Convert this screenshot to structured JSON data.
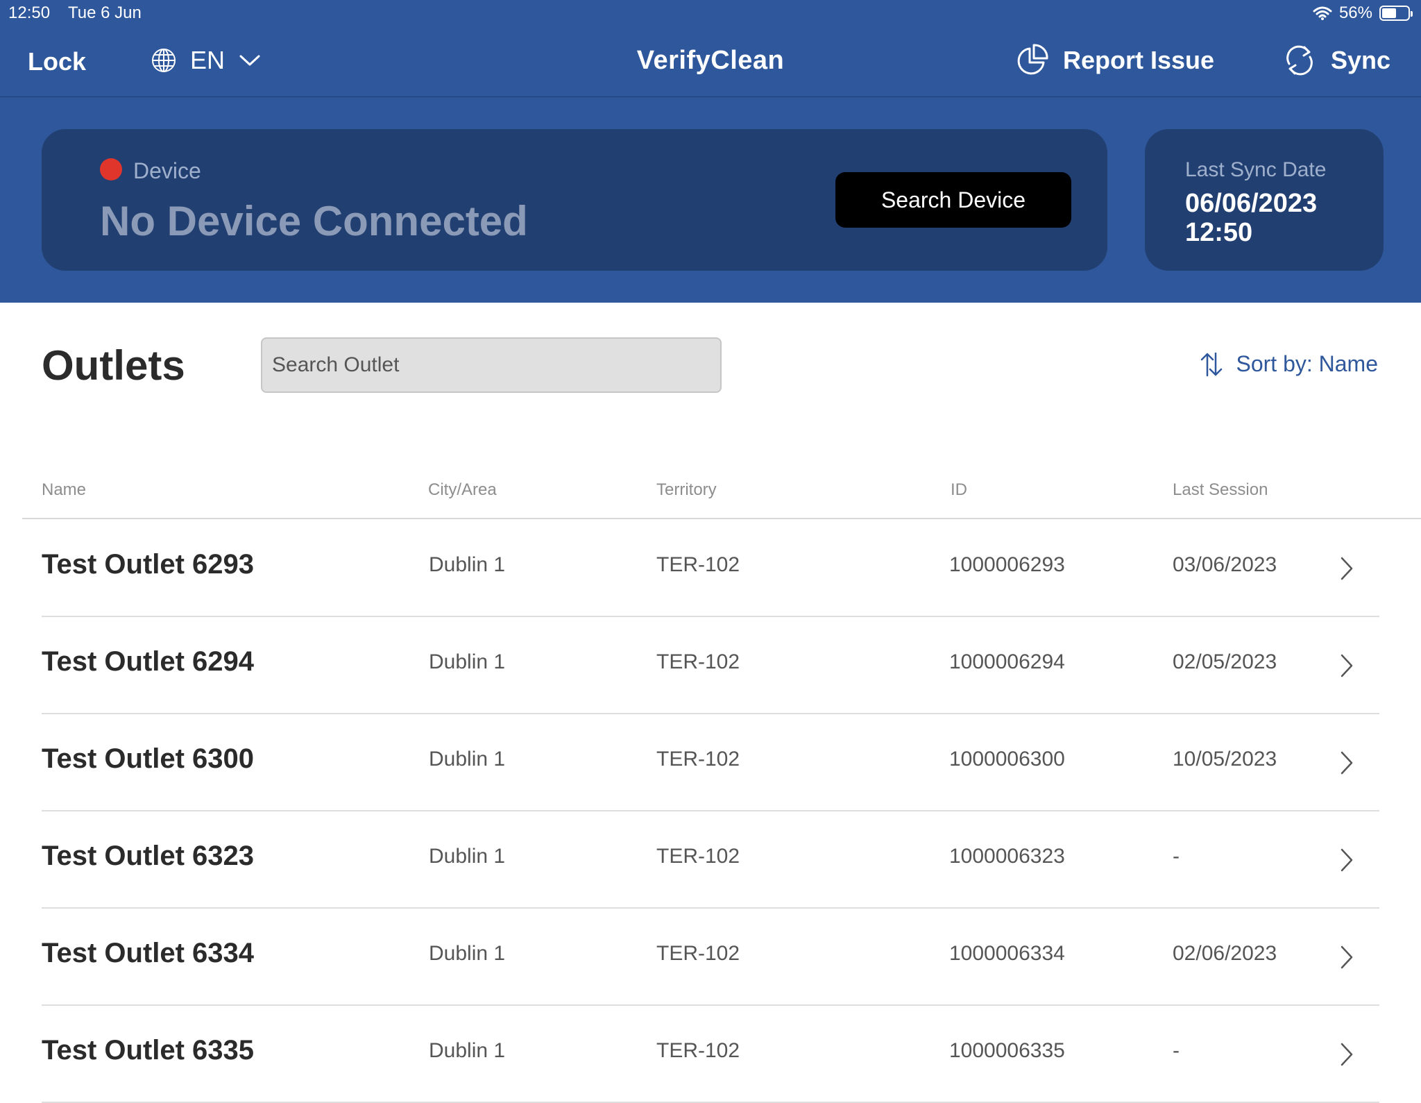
{
  "status_bar": {
    "time": "12:50",
    "date": "Tue 6 Jun",
    "battery": "56%",
    "battery_level": 0.56
  },
  "nav": {
    "lock_label": "Lock",
    "language": "EN",
    "title": "VerifyClean",
    "report_label": "Report Issue",
    "sync_label": "Sync"
  },
  "device": {
    "label": "Device",
    "status": "No Device Connected",
    "status_color": "#e0352b",
    "search_button": "Search Device"
  },
  "last_sync": {
    "label": "Last Sync Date",
    "date": "06/06/2023",
    "time": "12:50"
  },
  "outlets": {
    "title": "Outlets",
    "search_placeholder": "Search Outlet",
    "sort_label": "Sort by: Name",
    "columns": [
      "Name",
      "City/Area",
      "Territory",
      "ID",
      "Last Session"
    ],
    "rows": [
      {
        "name": "Test Outlet 6293",
        "city": "Dublin 1",
        "territory": "TER-102",
        "id": "1000006293",
        "last_session": "03/06/2023"
      },
      {
        "name": "Test Outlet 6294",
        "city": "Dublin 1",
        "territory": "TER-102",
        "id": "1000006294",
        "last_session": "02/05/2023"
      },
      {
        "name": "Test Outlet 6300",
        "city": "Dublin 1",
        "territory": "TER-102",
        "id": "1000006300",
        "last_session": "10/05/2023"
      },
      {
        "name": "Test Outlet 6323",
        "city": "Dublin 1",
        "territory": "TER-102",
        "id": "1000006323",
        "last_session": "-"
      },
      {
        "name": "Test Outlet 6334",
        "city": "Dublin 1",
        "territory": "TER-102",
        "id": "1000006334",
        "last_session": "02/06/2023"
      },
      {
        "name": "Test Outlet 6335",
        "city": "Dublin 1",
        "territory": "TER-102",
        "id": "1000006335",
        "last_session": "-"
      }
    ]
  },
  "colors": {
    "header_blue": "#2e579c",
    "card_blue": "#223f72",
    "accent": "#2e579c"
  },
  "icons": [
    "globe-icon",
    "chevron-down-icon",
    "pie-chart-icon",
    "sync-icon",
    "sort-icon",
    "chevron-right-icon",
    "wifi-icon",
    "battery-icon"
  ]
}
